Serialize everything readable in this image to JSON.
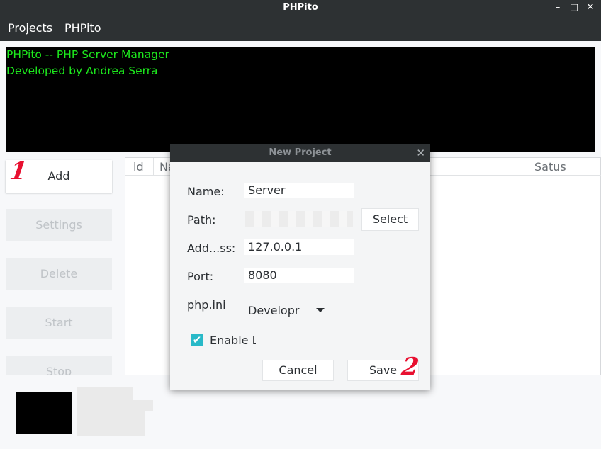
{
  "window": {
    "title": "PHPito",
    "controls": {
      "minimize": "–",
      "maximize": "□",
      "close": "✕"
    }
  },
  "menubar": {
    "items": [
      "Projects",
      "PHPito"
    ]
  },
  "terminal": {
    "lines": [
      "PHPito -- PHP Server Manager",
      "Developed by Andrea Serra"
    ],
    "text_color": "#1de91d"
  },
  "sidebar": {
    "buttons": [
      {
        "label": "Add",
        "enabled": true
      },
      {
        "label": "Settings",
        "enabled": false
      },
      {
        "label": "Delete",
        "enabled": false
      },
      {
        "label": "Start",
        "enabled": false
      },
      {
        "label": "Stop",
        "enabled": false
      }
    ]
  },
  "table": {
    "columns": [
      "id",
      "Na",
      "Satus"
    ]
  },
  "annotations": {
    "step1": "1",
    "step2": "2"
  },
  "dialog": {
    "title": "New Project",
    "close_icon": "close-icon",
    "name_label": "Name:",
    "name_value": "Server",
    "path_label": "Path:",
    "path_value": "",
    "select_button": "Select",
    "address_label": "Add...ss:",
    "address_value": "127.0.0.1",
    "port_label": "Port:",
    "port_value": "8080",
    "phpini_label": "php.ini",
    "phpini_selected": "Developr",
    "enable_label": "Enable L",
    "enable_checked": true,
    "cancel_button": "Cancel",
    "save_button": "Save"
  },
  "colors": {
    "titlebar": "#2d3133",
    "accent": "#28b9c8",
    "annotation": "#e81030"
  }
}
